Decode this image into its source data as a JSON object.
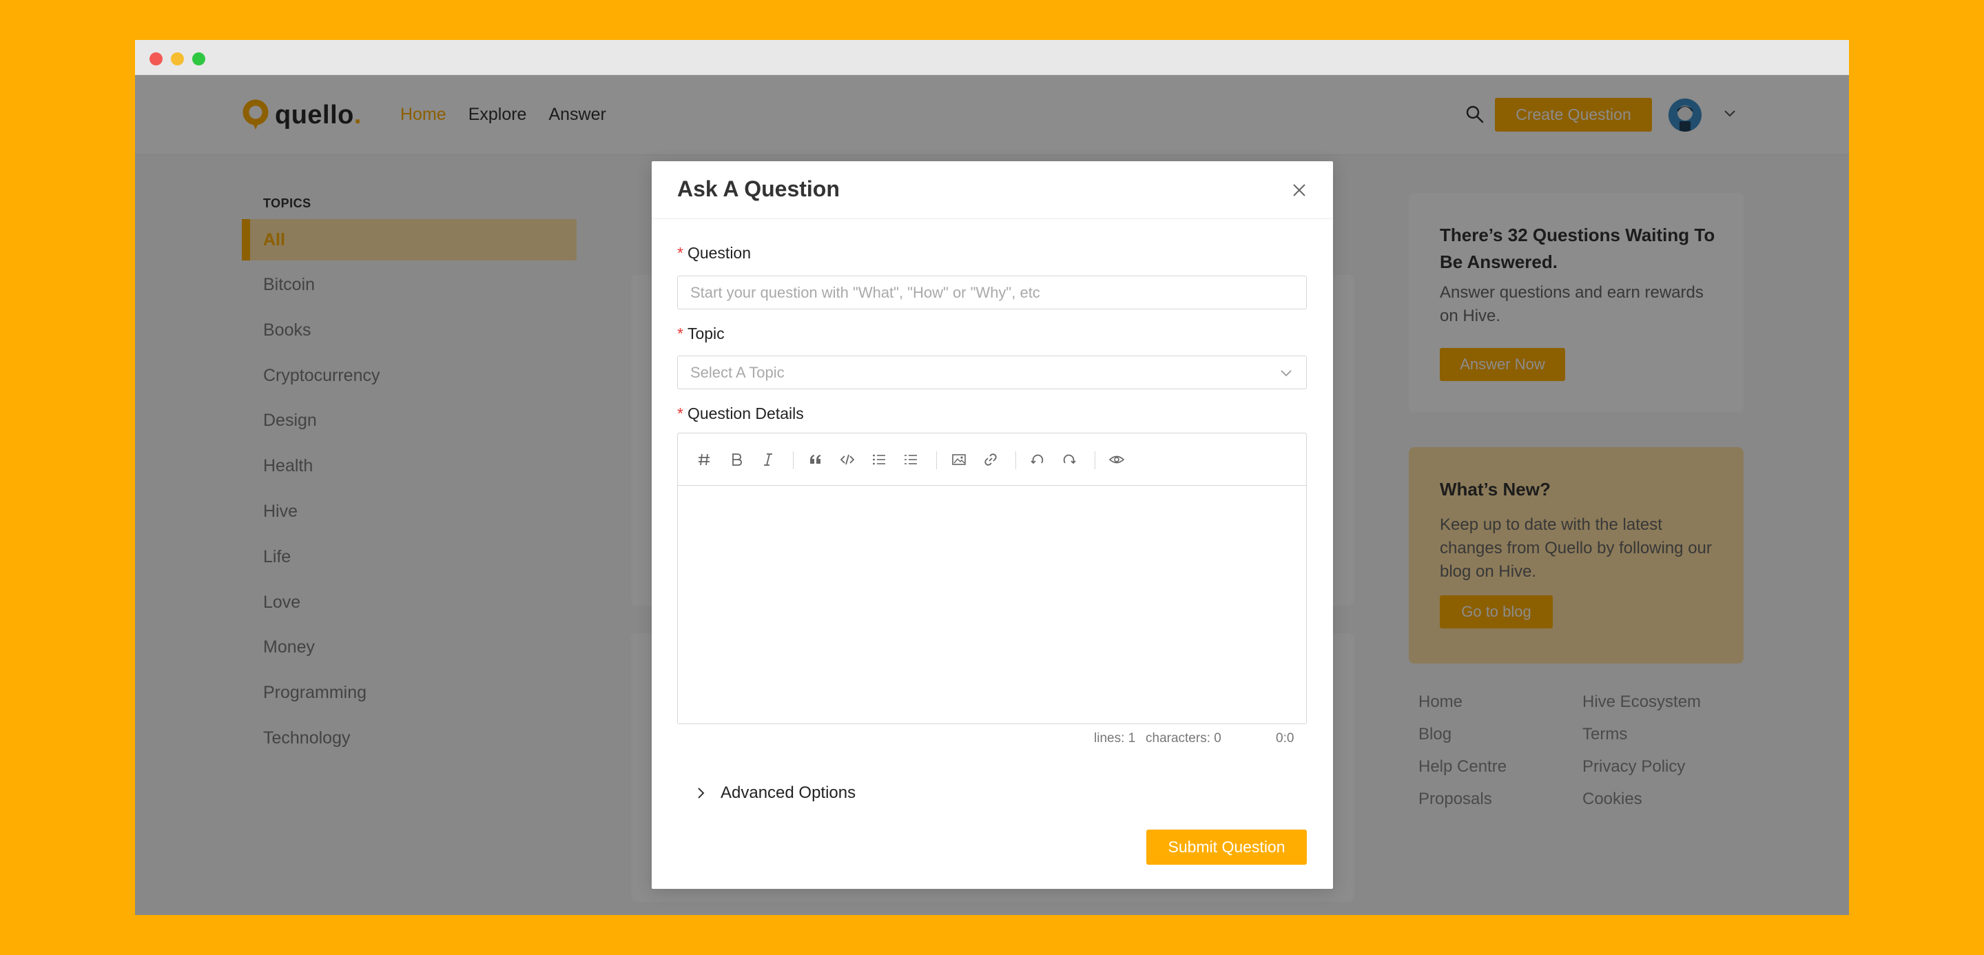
{
  "colors": {
    "accent": "#FFAD00",
    "background": "#FFAD00",
    "required": "#e53935"
  },
  "header": {
    "logo_text": "quello",
    "logo_dot": ".",
    "nav": [
      {
        "label": "Home",
        "active": true
      },
      {
        "label": "Explore",
        "active": false
      },
      {
        "label": "Answer",
        "active": false
      }
    ],
    "create_label": "Create Question"
  },
  "sidebar": {
    "title": "TOPICS",
    "active_topic": "All",
    "topics": [
      "Bitcoin",
      "Books",
      "Cryptocurrency",
      "Design",
      "Health",
      "Hive",
      "Life",
      "Love",
      "Money",
      "Programming",
      "Technology"
    ]
  },
  "waiting_card": {
    "title": "There’s 32 Questions Waiting To Be Answered.",
    "text": "Answer questions and earn rewards on Hive.",
    "button": "Answer Now"
  },
  "news_card": {
    "title": "What’s New?",
    "text": "Keep up to date with the latest changes from Quello by following our blog on Hive.",
    "button": "Go to blog"
  },
  "footer": {
    "col1": [
      "Home",
      "Blog",
      "Help Centre",
      "Proposals"
    ],
    "col2": [
      "Hive Ecosystem",
      "Terms",
      "Privacy Policy",
      "Cookies"
    ]
  },
  "modal": {
    "title": "Ask A Question",
    "close_label": "X",
    "question_label": "Question",
    "question_placeholder": "Start your question with \"What\", \"How\" or \"Why\", etc",
    "question_value": "",
    "topic_label": "Topic",
    "topic_placeholder": "Select A Topic",
    "details_label": "Question Details",
    "toolbar_icons": [
      "heading-icon",
      "bold-icon",
      "italic-icon",
      "quote-icon",
      "code-icon",
      "unordered-list-icon",
      "ordered-list-icon",
      "image-icon",
      "link-icon",
      "undo-icon",
      "redo-icon",
      "preview-icon"
    ],
    "status_lines": "lines: 1",
    "status_chars": "characters: 0",
    "status_pos": "0:0",
    "advanced_label": "Advanced Options",
    "submit_label": "Submit Question"
  }
}
